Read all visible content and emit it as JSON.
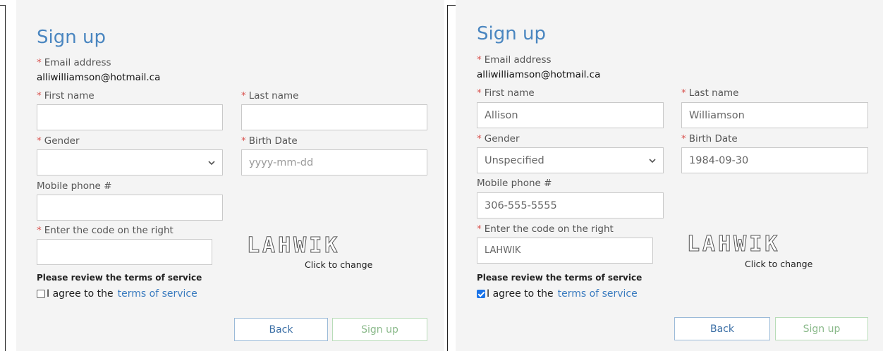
{
  "left": {
    "title": "Sign up",
    "email_label": "Email address",
    "email_value": "alliwilliamson@hotmail.ca",
    "first_name_label": "First name",
    "first_name_value": "",
    "last_name_label": "Last name",
    "last_name_value": "",
    "gender_label": "Gender",
    "gender_value": "",
    "birth_label": "Birth Date",
    "birth_placeholder": "yyyy-mm-dd",
    "mobile_label": "Mobile phone #",
    "mobile_value": "",
    "code_label": "Enter the code on the right",
    "code_value": "",
    "captcha_text": "LAHWIK",
    "captcha_hint": "Click to change",
    "terms_heading": "Please review the terms of service",
    "agree_text": "I agree to the",
    "terms_link": "terms of service",
    "agree_checked": false,
    "back_label": "Back",
    "signup_label": "Sign up"
  },
  "right": {
    "title": "Sign up",
    "email_label": "Email address",
    "email_value": "alliwilliamson@hotmail.ca",
    "first_name_label": "First name",
    "first_name_value": "Allison",
    "last_name_label": "Last name",
    "last_name_value": "Williamson",
    "gender_label": "Gender",
    "gender_value": "Unspecified",
    "birth_label": "Birth Date",
    "birth_value": "1984-09-30",
    "mobile_label": "Mobile phone #",
    "mobile_value": "306-555-5555",
    "code_label": "Enter the code on the right",
    "code_value": "LAHWIK",
    "captcha_text": "LAHWIK",
    "captcha_hint": "Click to change",
    "terms_heading": "Please review the terms of service",
    "agree_text": "I agree to the",
    "terms_link": "terms of service",
    "agree_checked": true,
    "back_label": "Back",
    "signup_label": "Sign up"
  },
  "colors": {
    "title": "#4a86c0",
    "required": "#d9534f",
    "link": "#3a7bbf",
    "panel_bg": "#f4f4f4"
  }
}
